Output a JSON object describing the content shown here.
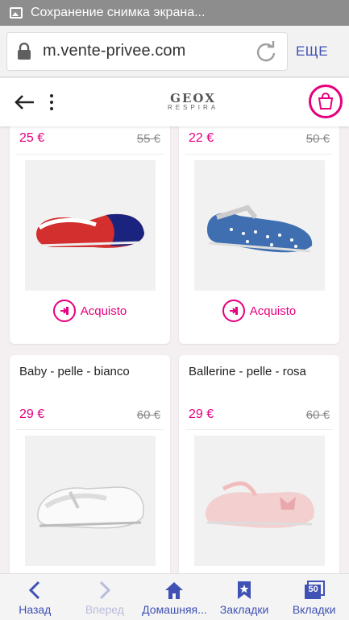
{
  "status_bar": {
    "title": "Сохранение снимка экрана..."
  },
  "browser": {
    "url": "m.vente-privee.com",
    "more_label": "ЕЩЕ"
  },
  "site": {
    "brand_top": "GEOX",
    "brand_bottom": "RESPIRA"
  },
  "products": [
    {
      "price": "25 €",
      "old_price": "55 €",
      "buy_label": "Acquisto",
      "image": "red-blue-ballerina-shoe"
    },
    {
      "price": "22 €",
      "old_price": "50 €",
      "buy_label": "Acquisto",
      "image": "denim-heart-mary-jane-shoe"
    },
    {
      "name": "Baby - pelle - bianco",
      "price": "29 €",
      "old_price": "60 €",
      "image": "white-baby-shoe"
    },
    {
      "name": "Ballerine - pelle - rosa",
      "price": "29 €",
      "old_price": "60 €",
      "image": "pink-ballerina-shoe"
    }
  ],
  "bottom_nav": [
    {
      "label": "Назад",
      "icon": "chevron-left-icon"
    },
    {
      "label": "Вперед",
      "icon": "chevron-right-icon",
      "disabled": true
    },
    {
      "label": "Домашняя...",
      "icon": "home-icon"
    },
    {
      "label": "Закладки",
      "icon": "bookmark-icon"
    },
    {
      "label": "Вкладки",
      "icon": "tabs-icon",
      "badge": "50"
    }
  ],
  "colors": {
    "accent": "#e6007e",
    "browser_blue": "#3f51b5",
    "status_gray": "#8d8d8d"
  }
}
